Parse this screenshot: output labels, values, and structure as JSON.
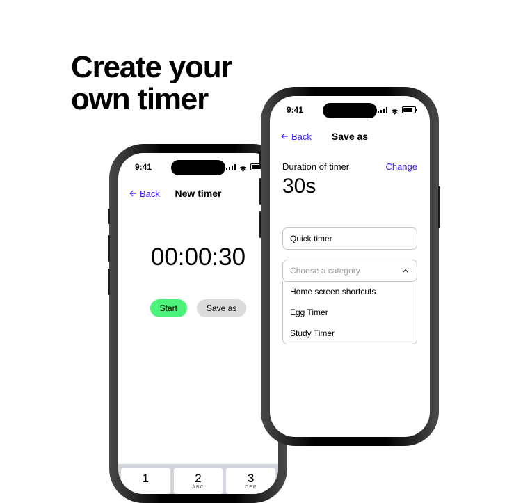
{
  "headline_l1": "Create your",
  "headline_l2": "own timer",
  "status": {
    "time": "9:41"
  },
  "phone1": {
    "back": "Back",
    "title": "New timer",
    "time": "00:00:30",
    "start": "Start",
    "save_as": "Save as",
    "keys": {
      "k1": "1",
      "k2": "2",
      "k2s": "ABC",
      "k3": "3",
      "k3s": "DEF"
    }
  },
  "phone2": {
    "back": "Back",
    "title": "Save as",
    "duration_label": "Duration of timer",
    "change": "Change",
    "duration_value": "30s",
    "name_value": "Quick timer",
    "category_placeholder": "Choose a category",
    "options": {
      "o1": "Home screen shortcuts",
      "o2": "Egg Timer",
      "o3": "Study Timer"
    }
  }
}
